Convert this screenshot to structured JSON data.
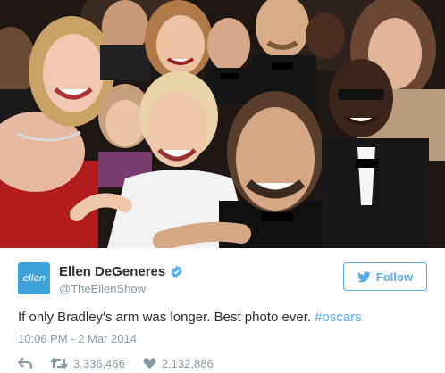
{
  "tweet": {
    "avatar_text": "ellen",
    "display_name": "Ellen DeGeneres",
    "verified_icon": "verified-badge-icon",
    "handle": "@TheEllenShow",
    "follow_label": "Follow",
    "text_main": "If only Bradley's arm was longer. Best photo ever. ",
    "hashtag": "#oscars",
    "timestamp": "10:06 PM - 2 Mar 2014",
    "retweets": "3,336,466",
    "likes": "2,132,886"
  },
  "colors": {
    "accent": "#55acee",
    "text": "#292f33",
    "muted": "#8899a6",
    "avatar_bg": "#3fa3d9"
  },
  "icons": {
    "reply": "reply-icon",
    "retweet": "retweet-icon",
    "like": "heart-icon",
    "follow_bird": "twitter-bird-icon"
  }
}
